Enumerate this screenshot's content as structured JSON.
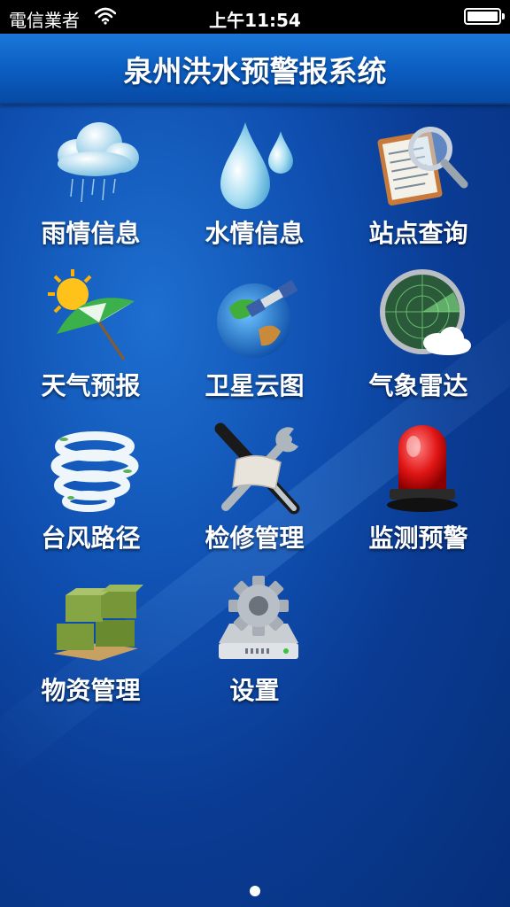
{
  "status_bar": {
    "carrier": "電信業者",
    "time": "上午11:54",
    "battery_level": 0.95
  },
  "header": {
    "title": "泉州洪水预警报系统"
  },
  "menu": {
    "items": [
      {
        "label": "雨情信息",
        "icon": "rain-cloud-icon"
      },
      {
        "label": "水情信息",
        "icon": "water-drop-icon"
      },
      {
        "label": "站点查询",
        "icon": "magnifier-clipboard-icon"
      },
      {
        "label": "天气预报",
        "icon": "sun-umbrella-icon"
      },
      {
        "label": "卫星云图",
        "icon": "satellite-globe-icon"
      },
      {
        "label": "气象雷达",
        "icon": "radar-icon"
      },
      {
        "label": "台风路径",
        "icon": "typhoon-icon"
      },
      {
        "label": "检修管理",
        "icon": "wrench-screwdriver-icon"
      },
      {
        "label": "监测预警",
        "icon": "alarm-siren-icon"
      },
      {
        "label": "物资管理",
        "icon": "supply-boxes-icon"
      },
      {
        "label": "设置",
        "icon": "settings-gear-icon"
      }
    ]
  },
  "pager": {
    "page_count": 1,
    "current_page": 1
  }
}
